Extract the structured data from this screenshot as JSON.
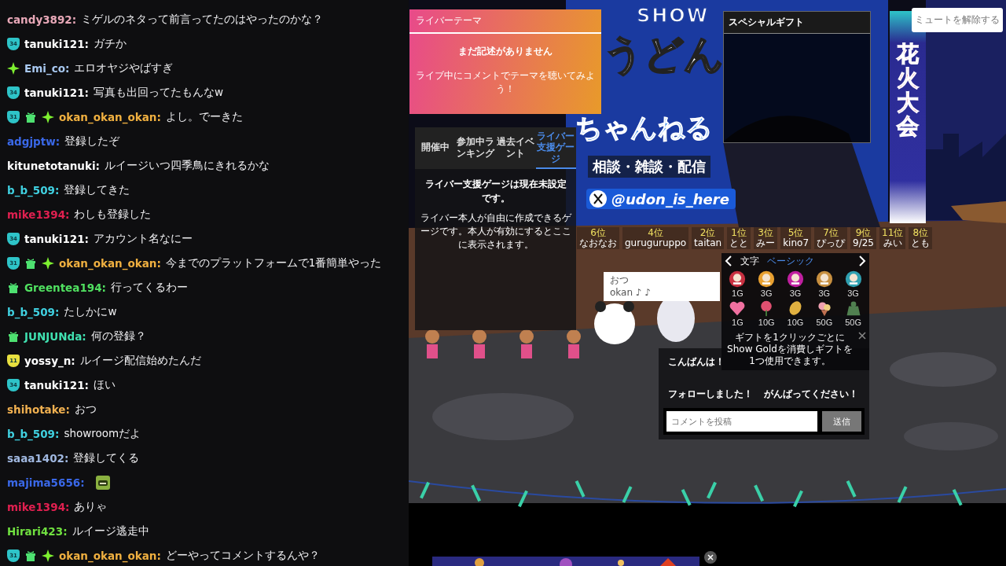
{
  "chat": {
    "messages": [
      {
        "user": "candy3892:",
        "color": "#e8a8b8",
        "text": "ミゲルのネタって前言ってたのはやったのかな？"
      },
      {
        "user": "tanuki121:",
        "color": "#ffffff",
        "badges": [
          {
            "kind": "sub",
            "label": "34",
            "color": "#2ec4c8"
          }
        ],
        "text": "ガチか"
      },
      {
        "user": "Emi_co:",
        "color": "#a8c8f0",
        "badges": [
          {
            "kind": "sparkle"
          }
        ],
        "text": "エロオヤジやばすぎ"
      },
      {
        "user": "tanuki121:",
        "color": "#ffffff",
        "badges": [
          {
            "kind": "sub",
            "label": "34",
            "color": "#2ec4c8"
          }
        ],
        "text": "写真も出回ってたもんなw"
      },
      {
        "user": "okan_okan_okan:",
        "color": "#f0b040",
        "badges": [
          {
            "kind": "sub",
            "label": "31",
            "color": "#2ec4c8"
          },
          {
            "kind": "gift"
          },
          {
            "kind": "sparkle"
          }
        ],
        "text": "よし。でーきた"
      },
      {
        "user": "adgjptw:",
        "color": "#3a68e8",
        "text": "登録したぞ"
      },
      {
        "user": "kitunetotanuki:",
        "color": "#ffffff",
        "text": "ルイージいつ四季鳥にきれるかな"
      },
      {
        "user": "b_b_509:",
        "color": "#40d0e0",
        "text": "登録してきた"
      },
      {
        "user": "mike1394:",
        "color": "#e02050",
        "text": "わしも登録した"
      },
      {
        "user": "tanuki121:",
        "color": "#ffffff",
        "badges": [
          {
            "kind": "sub",
            "label": "34",
            "color": "#2ec4c8"
          }
        ],
        "text": "アカウント名なにー"
      },
      {
        "user": "okan_okan_okan:",
        "color": "#f0b040",
        "badges": [
          {
            "kind": "sub",
            "label": "31",
            "color": "#2ec4c8"
          },
          {
            "kind": "gift"
          },
          {
            "kind": "sparkle"
          }
        ],
        "text": "今までのプラットフォームで1番簡単やった"
      },
      {
        "user": "Greentea194:",
        "color": "#50e060",
        "badges": [
          {
            "kind": "gift"
          }
        ],
        "text": "行ってくるわー"
      },
      {
        "user": "b_b_509:",
        "color": "#40d0e0",
        "text": "たしかにw"
      },
      {
        "user": "JUNJUNda:",
        "color": "#40e0b0",
        "badges": [
          {
            "kind": "gift"
          }
        ],
        "text": "何の登録？"
      },
      {
        "user": "yossy_n:",
        "color": "#ffffff",
        "badges": [
          {
            "kind": "sub",
            "label": "11",
            "color": "#e8e040"
          }
        ],
        "text": "ルイージ配信始めたんだ"
      },
      {
        "user": "tanuki121:",
        "color": "#ffffff",
        "badges": [
          {
            "kind": "sub",
            "label": "34",
            "color": "#2ec4c8"
          }
        ],
        "text": "ほい"
      },
      {
        "user": "shihotake:",
        "color": "#f0b050",
        "text": "おつ"
      },
      {
        "user": "b_b_509:",
        "color": "#40d0e0",
        "text": "showroomだよ"
      },
      {
        "user": "saaa1402:",
        "color": "#a0b8e0",
        "text": "登録してくる"
      },
      {
        "user": "majima5656:",
        "color": "#3a68e8",
        "emote": true
      },
      {
        "user": "mike1394:",
        "color": "#e02050",
        "text": "ありゃ"
      },
      {
        "user": "Hirari423:",
        "color": "#70e040",
        "text": "ルイージ逃走中"
      },
      {
        "user": "okan_okan_okan:",
        "color": "#f0b040",
        "badges": [
          {
            "kind": "sub",
            "label": "31",
            "color": "#2ec4c8"
          },
          {
            "kind": "gift"
          },
          {
            "kind": "sparkle"
          }
        ],
        "text": "どーやってコメントするんや？"
      }
    ]
  },
  "stream": {
    "theme_panel": {
      "title": "ライバーテーマ",
      "heading": "まだ記述がありません",
      "hint": "ライブ中にコメントでテーマを聴いてみよう！"
    },
    "event_panel": {
      "tabs": [
        {
          "label": "開催中",
          "selected": false
        },
        {
          "label": "参加中ランキング",
          "selected": false
        },
        {
          "label": "過去イベント",
          "selected": false
        },
        {
          "label": "ライバー支援ゲージ",
          "selected": true
        }
      ],
      "heading": "ライバー支援ゲージは現在未設定です。",
      "description": "ライバー本人が自由に作成できるゲージです。本人が有効にするとここに表示されます。"
    },
    "banner": {
      "logo": "SHOW",
      "title_1": "うどん",
      "title_2": "ちゃんねる",
      "tagline": "相談・雑談・配信",
      "handle": "@udon_is_here"
    },
    "special_gift": {
      "title": "スペシャルギフト"
    },
    "side_banner": "花火大会",
    "mute_tooltip": "ミュートを解除する",
    "rankings": [
      {
        "rank": "6位",
        "name": "なおなお"
      },
      {
        "rank": "4位",
        "name": "guruguruppo"
      },
      {
        "rank": "2位",
        "name": "taitan"
      },
      {
        "rank": "1位",
        "name": "とと"
      },
      {
        "rank": "3位",
        "name": "みー"
      },
      {
        "rank": "5位",
        "name": "kino7"
      },
      {
        "rank": "7位",
        "name": "ぴっぴ"
      },
      {
        "rank": "9位",
        "name": "9/25"
      },
      {
        "rank": "11位",
        "name": "みい"
      },
      {
        "rank": "8位",
        "name": "とも"
      }
    ],
    "speech_bubble": {
      "lines": [
        "おつ",
        "okan ♪ ♪"
      ]
    },
    "gift_panel": {
      "tabs": [
        {
          "label": "文字",
          "selected": false
        },
        {
          "label": "ベーシック",
          "selected": true
        }
      ],
      "gifts": [
        {
          "kind": "daruma",
          "color": "#c83040",
          "price": "1G"
        },
        {
          "kind": "daruma",
          "color": "#e8a030",
          "price": "3G"
        },
        {
          "kind": "daruma",
          "color": "#c020a0",
          "price": "3G"
        },
        {
          "kind": "daruma",
          "color": "#c89040",
          "price": "3G"
        },
        {
          "kind": "daruma",
          "color": "#30a0b0",
          "price": "3G"
        },
        {
          "kind": "heart",
          "color": "#f070a0",
          "price": "1G"
        },
        {
          "kind": "flower",
          "color": "#e05070",
          "price": "10G"
        },
        {
          "kind": "bean",
          "color": "#e0b040",
          "price": "10G"
        },
        {
          "kind": "bouquet",
          "color": "#f0a0b0",
          "price": "50G"
        },
        {
          "kind": "bag",
          "color": "#508050",
          "price": "50G"
        }
      ],
      "note": "ギフトを1クリックごとにShow Goldを消費しギフトを1つ使用できます。"
    },
    "quick_comments": [
      "こんばんは！",
      "フォローしました！",
      "がんばってください！"
    ],
    "comment_box": {
      "placeholder": "コメントを投稿",
      "send": "送信"
    }
  }
}
